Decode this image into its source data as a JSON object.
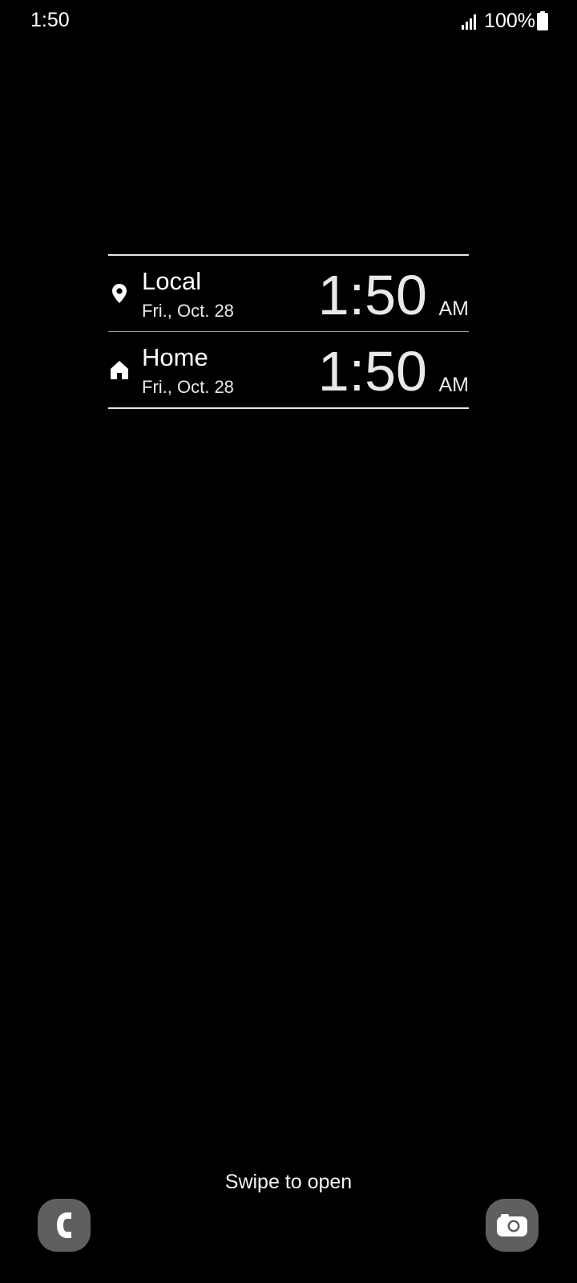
{
  "status_bar": {
    "time": "1:50",
    "battery": "100%",
    "signal_icon": "signal-bars-icon",
    "battery_icon": "battery-full-icon"
  },
  "world_clock": {
    "rows": [
      {
        "icon": "location-pin-icon",
        "label": "Local",
        "date": "Fri., Oct. 28",
        "time": "1:50",
        "ampm": "AM"
      },
      {
        "icon": "home-icon",
        "label": "Home",
        "date": "Fri., Oct. 28",
        "time": "1:50",
        "ampm": "AM"
      }
    ]
  },
  "lock_screen": {
    "swipe_text": "Swipe to open",
    "left_shortcut_icon": "phone-icon",
    "right_shortcut_icon": "camera-icon"
  },
  "colors": {
    "background": "#000000",
    "text": "#ffffff",
    "shortcut_bg": "#5f5f5f"
  }
}
